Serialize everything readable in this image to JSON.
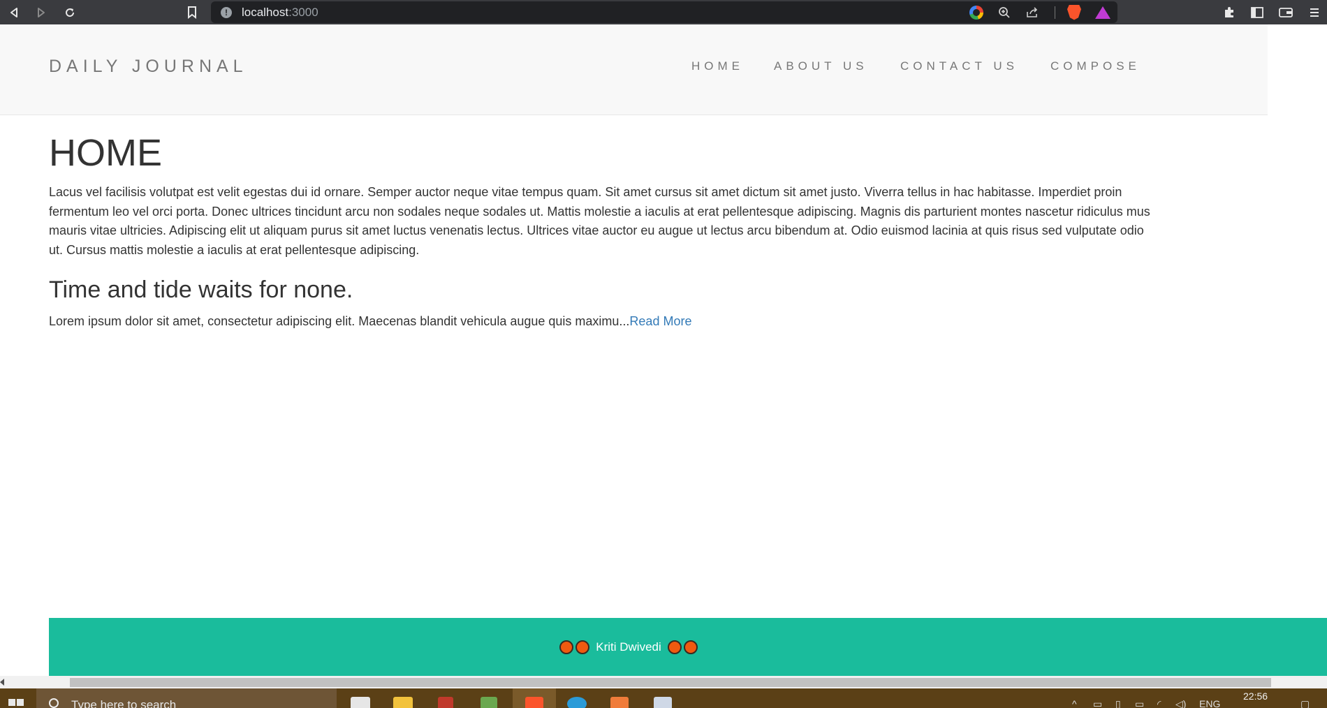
{
  "browser": {
    "url_host": "localhost",
    "url_port": ":3000"
  },
  "site": {
    "brand": "DAILY JOURNAL",
    "nav": [
      {
        "label": "HOME"
      },
      {
        "label": "ABOUT US"
      },
      {
        "label": "CONTACT US"
      },
      {
        "label": "COMPOSE"
      }
    ]
  },
  "main": {
    "title": "HOME",
    "intro": "Lacus vel facilisis volutpat est velit egestas dui id ornare. Semper auctor neque vitae tempus quam. Sit amet cursus sit amet dictum sit amet justo. Viverra tellus in hac habitasse. Imperdiet proin fermentum leo vel orci porta. Donec ultrices tincidunt arcu non sodales neque sodales ut. Mattis molestie a iaculis at erat pellentesque adipiscing. Magnis dis parturient montes nascetur ridiculus mus mauris vitae ultricies. Adipiscing elit ut aliquam purus sit amet luctus venenatis lectus. Ultrices vitae auctor eu augue ut lectus arcu bibendum at. Odio euismod lacinia at quis risus sed vulputate odio ut. Cursus mattis molestie a iaculis at erat pellentesque adipiscing.",
    "posts": [
      {
        "title": "Time and tide waits for none.",
        "excerpt": "Lorem ipsum dolor sit amet, consectetur adipiscing elit. Maecenas blandit vehicula augue quis maximu...",
        "read_more": "Read More"
      }
    ]
  },
  "footer": {
    "name": "Kriti Dwivedi"
  },
  "taskbar": {
    "search_placeholder": "Type here to search",
    "language": "ENG",
    "time": "22:56"
  },
  "colors": {
    "footer_bg": "#1abc9c",
    "link": "#337ab7",
    "header_bg": "#f8f8f8",
    "dot": "#f05a10"
  }
}
